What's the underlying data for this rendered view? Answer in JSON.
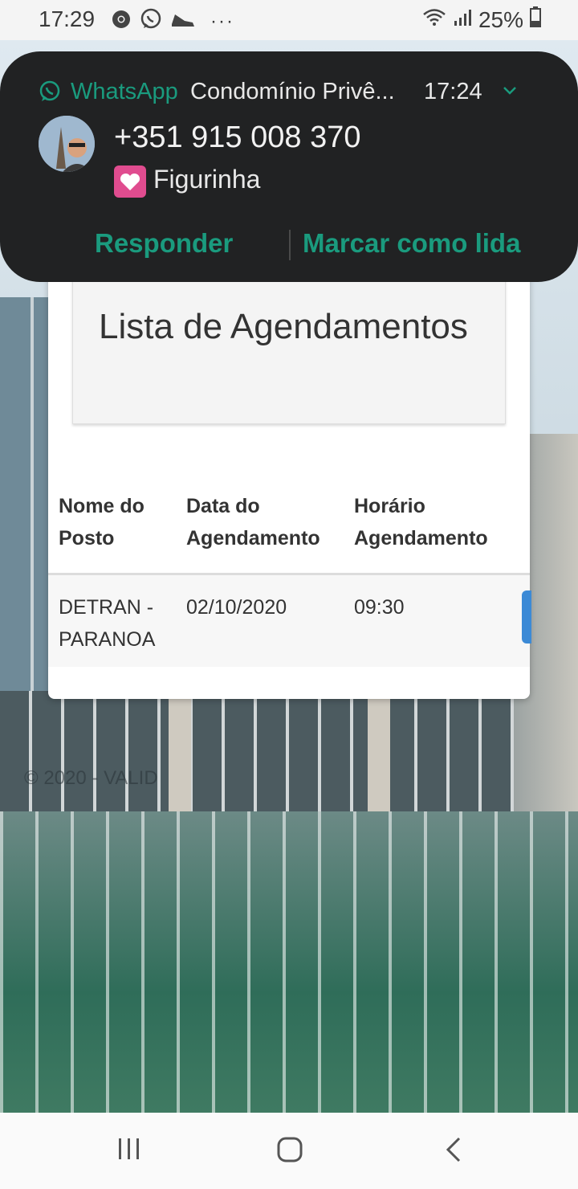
{
  "status_bar": {
    "time": "17:29",
    "left_icons": [
      "chrome-icon",
      "whatsapp-icon",
      "shoe-icon",
      "more-dots-icon"
    ],
    "battery": "25%"
  },
  "notification": {
    "app_name": "WhatsApp",
    "conversation": "Condomínio Privê...",
    "time": "17:24",
    "sender": "+351 915 008 370",
    "message": "Figurinha",
    "actions": {
      "reply": "Responder",
      "mark_read": "Marcar como lida"
    }
  },
  "card": {
    "title": "Lista de Agendamentos",
    "table": {
      "headers": [
        "Nome do Posto",
        "Data do Agendamento",
        "Horário Agendamento"
      ],
      "rows": [
        {
          "posto": "DETRAN - PARANOA",
          "data": "02/10/2020",
          "horario": "09:30"
        }
      ]
    }
  },
  "footer": {
    "copyright": "© 2020 - VALID"
  },
  "colors": {
    "whatsapp_green": "#1a9b7e",
    "notification_bg": "#212223",
    "action_blue": "#3c8ad6"
  }
}
